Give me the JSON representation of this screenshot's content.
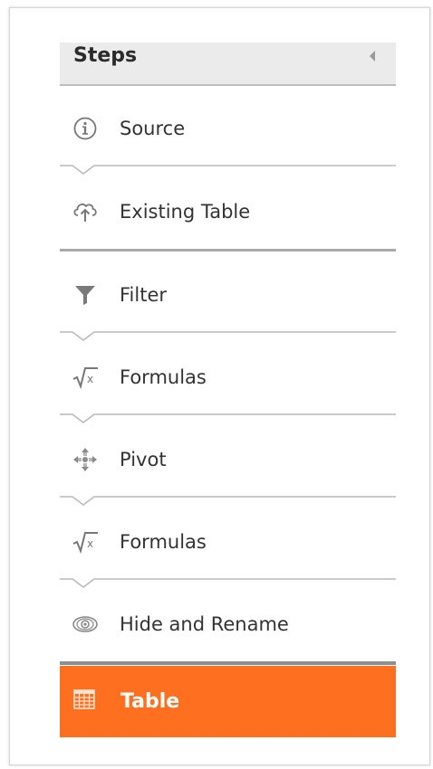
{
  "panel": {
    "title": "Steps",
    "collapse_icon": "collapse-left-icon"
  },
  "steps": [
    {
      "label": "Source",
      "icon": "info-icon"
    },
    {
      "label": "Existing Table",
      "icon": "cloud-upload-icon"
    },
    {
      "label": "Filter",
      "icon": "funnel-icon"
    },
    {
      "label": "Formulas",
      "icon": "square-root-icon"
    },
    {
      "label": "Pivot",
      "icon": "move-arrows-icon"
    },
    {
      "label": "Formulas",
      "icon": "square-root-icon"
    },
    {
      "label": "Hide and Rename",
      "icon": "eye-icon"
    }
  ],
  "active_step": {
    "label": "Table",
    "icon": "table-grid-icon",
    "color": "#FF6F20"
  },
  "colors": {
    "header_bg": "#EBEBEB",
    "icon_gray": "#777777",
    "text": "#333333"
  }
}
